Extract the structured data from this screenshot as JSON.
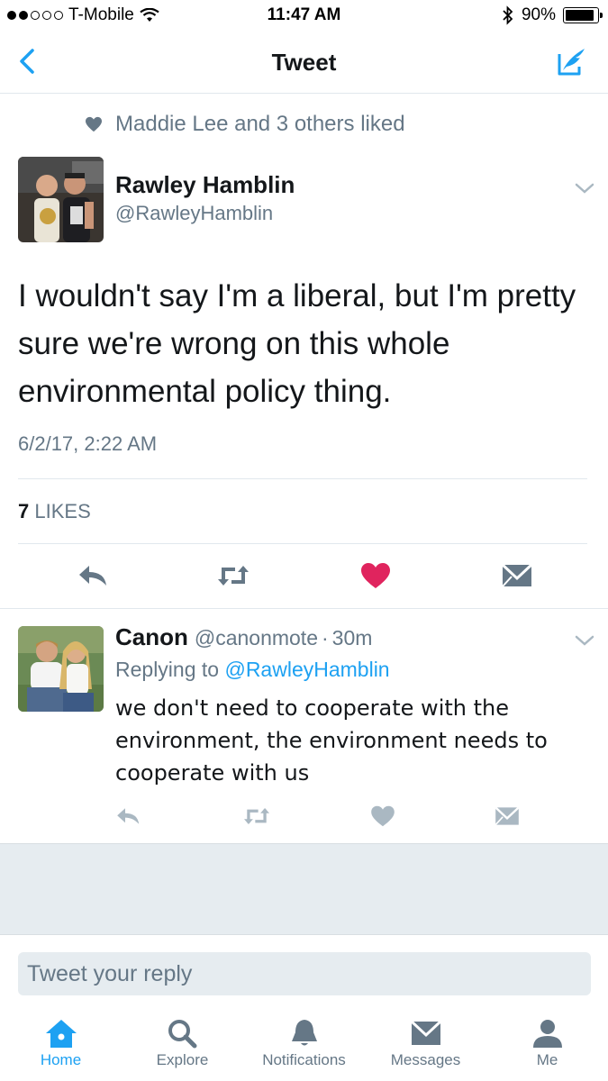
{
  "status_bar": {
    "carrier": "T-Mobile",
    "time": "11:47 AM",
    "battery": "90%",
    "battery_level": 0.9
  },
  "nav": {
    "title": "Tweet"
  },
  "social_context": {
    "text": "Maddie Lee and 3 others liked"
  },
  "tweet": {
    "author_name": "Rawley Hamblin",
    "author_handle": "@RawleyHamblin",
    "text": "I wouldn't say I'm a liberal, but I'm pretty sure we're wrong on this whole environmental policy thing.",
    "timestamp": "6/2/17, 2:22 AM",
    "likes_count": "7",
    "likes_label": "LIKES",
    "liked": true
  },
  "reply": {
    "author_name": "Canon",
    "author_handle": "@canonmote",
    "separator": "·",
    "time_ago": "30m",
    "replying_prefix": "Replying to",
    "replying_to": "@RawleyHamblin",
    "text": "we don't need to cooperate with the environment, the environment needs to cooperate with us"
  },
  "reply_box": {
    "placeholder": "Tweet your reply"
  },
  "tabs": [
    {
      "label": "Home",
      "icon": "home-icon",
      "active": true
    },
    {
      "label": "Explore",
      "icon": "search-icon",
      "active": false
    },
    {
      "label": "Notifications",
      "icon": "bell-icon",
      "active": false
    },
    {
      "label": "Messages",
      "icon": "envelope-icon",
      "active": false
    },
    {
      "label": "Me",
      "icon": "person-icon",
      "active": false
    }
  ],
  "colors": {
    "accent": "#1da1f2",
    "like": "#e0245e",
    "muted": "#657786",
    "text": "#14171a"
  }
}
